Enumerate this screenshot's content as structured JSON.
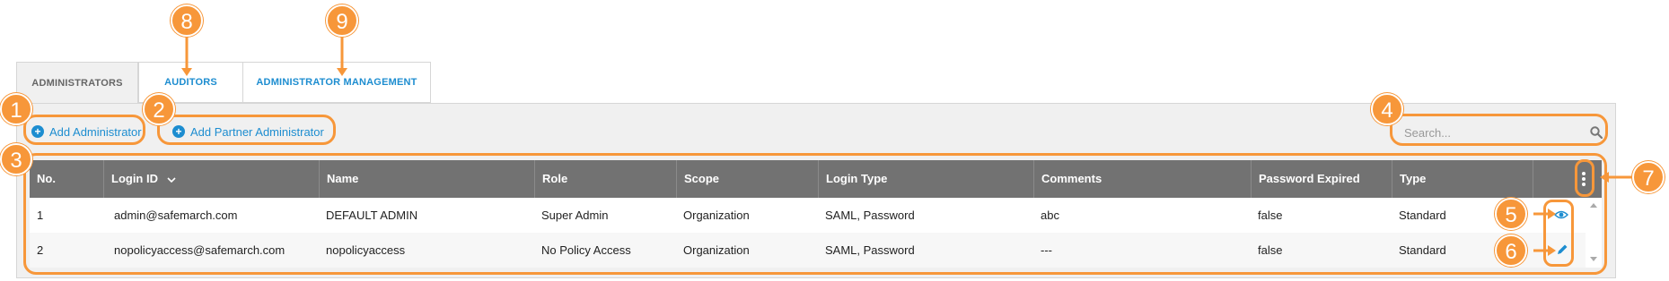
{
  "tabs": [
    {
      "label": "ADMINISTRATORS",
      "active": true
    },
    {
      "label": "AUDITORS",
      "active": false
    },
    {
      "label": "ADMINISTRATOR MANAGEMENT",
      "active": false
    }
  ],
  "actions": {
    "add_admin": "Add Administrator",
    "add_partner_admin": "Add Partner Administrator"
  },
  "search": {
    "placeholder": "Search..."
  },
  "table": {
    "columns": [
      "No.",
      "Login ID",
      "Name",
      "Role",
      "Scope",
      "Login Type",
      "Comments",
      "Password Expired",
      "Type"
    ],
    "rows": [
      [
        "1",
        "admin@safemarch.com",
        "DEFAULT ADMIN",
        "Super Admin",
        "Organization",
        "SAML, Password",
        "abc",
        "false",
        "Standard"
      ],
      [
        "2",
        "nopolicyaccess@safemarch.com",
        "nopolicyaccess",
        "No Policy Access",
        "Organization",
        "SAML, Password",
        "---",
        "false",
        "Standard"
      ]
    ]
  },
  "callouts": [
    "1",
    "2",
    "3",
    "4",
    "5",
    "6",
    "7",
    "8",
    "9"
  ],
  "colors": {
    "accent": "#1d8dd0",
    "callout": "#f7973a",
    "header": "#727272"
  },
  "icons": {
    "sort": "chevron-down-icon",
    "search": "search-icon",
    "view": "eye-icon",
    "edit": "pencil-icon",
    "columns": "kebab-menu-icon"
  }
}
